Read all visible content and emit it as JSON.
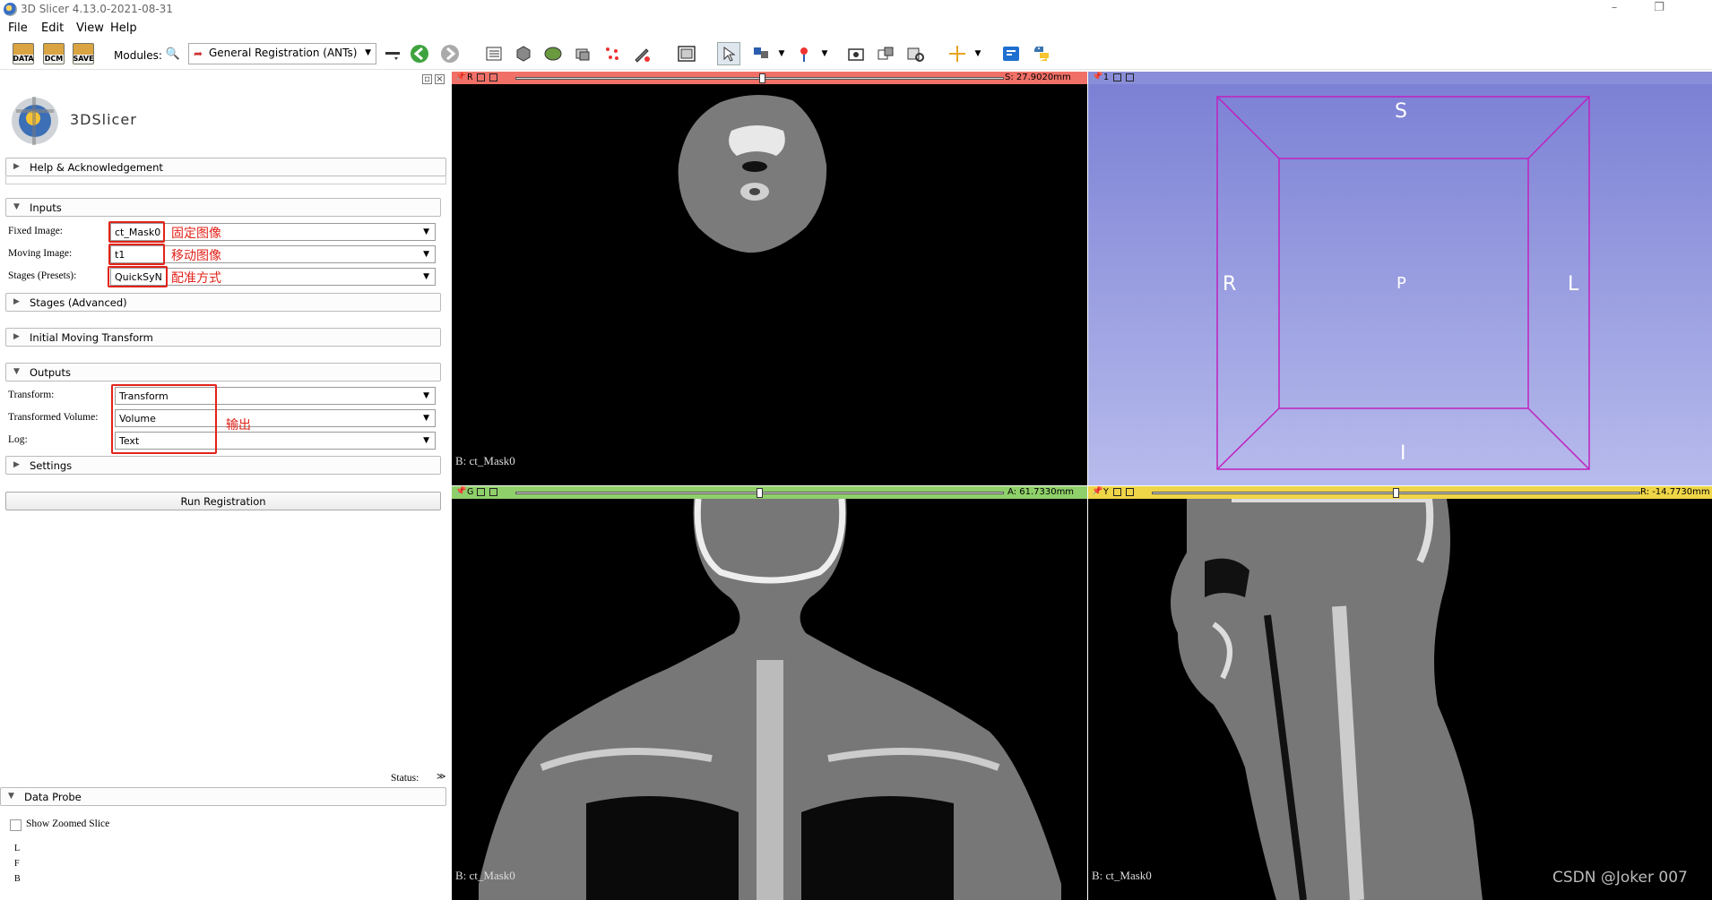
{
  "window": {
    "title": "3D Slicer 4.13.0-2021-08-31",
    "min_glyph": "–",
    "restore_glyph": "❐"
  },
  "menu": [
    "File",
    "Edit",
    "View",
    "Help"
  ],
  "toolbar": {
    "data_label": "DATA",
    "dcm_label": "DCM",
    "save_label": "SAVE",
    "modules_label": "Modules:",
    "module_value": "General Registration (ANTs)"
  },
  "left": {
    "logo_text": "3DSlicer",
    "help_section": "Help & Acknowledgement",
    "inputs_section": "Inputs",
    "fixed_label": "Fixed Image:",
    "fixed_value": "ct_Mask0",
    "moving_label": "Moving Image:",
    "moving_value": "t1",
    "stages_label": "Stages (Presets):",
    "stages_value": "QuickSyN",
    "stages_adv_section": "Stages (Advanced)",
    "init_section": "Initial Moving Transform",
    "outputs_section": "Outputs",
    "transform_label": "Transform:",
    "transform_value": "Transform",
    "tvolume_label": "Transformed Volume:",
    "tvolume_value": "Volume",
    "log_label": "Log:",
    "log_value": "Text",
    "settings_section": "Settings",
    "run_button": "Run Registration",
    "status_label": "Status:",
    "probe_section": "Data Probe",
    "zoom_label": "Show Zoomed Slice",
    "probe_rows": [
      "L",
      "F",
      "B"
    ]
  },
  "annotations": {
    "fixed": "固定图像",
    "moving": "移动图像",
    "stages": "配准方式",
    "outputs": "输出"
  },
  "views": {
    "red": {
      "letter": "R",
      "offset": "S: 27.9020mm",
      "bg_label": "B: ct_Mask0",
      "bar_color": "#f07067"
    },
    "threed": {
      "letter": "1",
      "S": "S",
      "R": "R",
      "L": "L",
      "P": "P",
      "I": "I",
      "bar_color": "#8a8ed8"
    },
    "green": {
      "letter": "G",
      "offset": "A: 61.7330mm",
      "bg_label": "B: ct_Mask0",
      "bar_color": "#8fd06a"
    },
    "yellow": {
      "letter": "Y",
      "offset": "R: -14.7730mm",
      "bg_label": "B: ct_Mask0",
      "bar_color": "#efd548"
    }
  },
  "watermark": "CSDN @Joker 007"
}
